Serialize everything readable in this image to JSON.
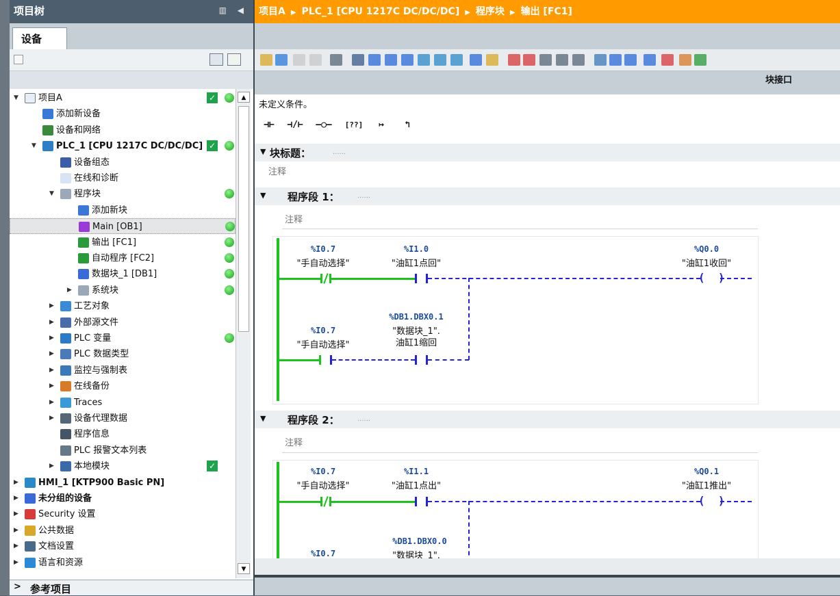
{
  "left_panel": {
    "header_title": "项目树",
    "device_tab": "设备",
    "tree": [
      {
        "label": "项目A",
        "arrow": "▼",
        "indent": 0,
        "bold": false,
        "icon": "project",
        "check": true,
        "dot": true
      },
      {
        "label": "添加新设备",
        "arrow": "",
        "indent": 1,
        "bold": false,
        "icon": "add-device"
      },
      {
        "label": "设备和网络",
        "arrow": "",
        "indent": 1,
        "bold": false,
        "icon": "network"
      },
      {
        "label": "PLC_1 [CPU 1217C DC/DC/DC]",
        "arrow": "▼",
        "indent": 1,
        "bold": true,
        "icon": "plc",
        "check": true,
        "dot": true
      },
      {
        "label": "设备组态",
        "arrow": "",
        "indent": 2,
        "bold": false,
        "icon": "device-config"
      },
      {
        "label": "在线和诊断",
        "arrow": "",
        "indent": 2,
        "bold": false,
        "icon": "diagnostics"
      },
      {
        "label": "程序块",
        "arrow": "▼",
        "indent": 2,
        "bold": false,
        "icon": "folder",
        "dot": true
      },
      {
        "label": "添加新块",
        "arrow": "",
        "indent": 3,
        "bold": false,
        "icon": "add-block"
      },
      {
        "label": "Main [OB1]",
        "arrow": "",
        "indent": 3,
        "bold": false,
        "icon": "ob",
        "dot": true,
        "selected": true
      },
      {
        "label": "输出 [FC1]",
        "arrow": "",
        "indent": 3,
        "bold": false,
        "icon": "fc",
        "dot": true
      },
      {
        "label": "自动程序 [FC2]",
        "arrow": "",
        "indent": 3,
        "bold": false,
        "icon": "fc",
        "dot": true
      },
      {
        "label": "数据块_1 [DB1]",
        "arrow": "",
        "indent": 3,
        "bold": false,
        "icon": "db",
        "dot": true
      },
      {
        "label": "系统块",
        "arrow": "▶",
        "indent": 3,
        "bold": false,
        "icon": "folder",
        "dot": true
      },
      {
        "label": "工艺对象",
        "arrow": "▶",
        "indent": 2,
        "bold": false,
        "icon": "tech"
      },
      {
        "label": "外部源文件",
        "arrow": "▶",
        "indent": 2,
        "bold": false,
        "icon": "ext"
      },
      {
        "label": "PLC 变量",
        "arrow": "▶",
        "indent": 2,
        "bold": false,
        "icon": "tags",
        "dot": true
      },
      {
        "label": "PLC 数据类型",
        "arrow": "▶",
        "indent": 2,
        "bold": false,
        "icon": "types"
      },
      {
        "label": "监控与强制表",
        "arrow": "▶",
        "indent": 2,
        "bold": false,
        "icon": "watch"
      },
      {
        "label": "在线备份",
        "arrow": "▶",
        "indent": 2,
        "bold": false,
        "icon": "backup"
      },
      {
        "label": "Traces",
        "arrow": "▶",
        "indent": 2,
        "bold": false,
        "icon": "traces"
      },
      {
        "label": "设备代理数据",
        "arrow": "▶",
        "indent": 2,
        "bold": false,
        "icon": "proxy"
      },
      {
        "label": "程序信息",
        "arrow": "",
        "indent": 2,
        "bold": false,
        "icon": "info"
      },
      {
        "label": "PLC 报警文本列表",
        "arrow": "",
        "indent": 2,
        "bold": false,
        "icon": "alarm"
      },
      {
        "label": "本地模块",
        "arrow": "▶",
        "indent": 2,
        "bold": false,
        "icon": "local",
        "check": true
      },
      {
        "label": "HMI_1 [KTP900 Basic PN]",
        "arrow": "▶",
        "indent": 0,
        "bold": true,
        "icon": "hmi"
      },
      {
        "label": "未分组的设备",
        "arrow": "▶",
        "indent": 0,
        "bold": true,
        "icon": "ungrouped"
      },
      {
        "label": "Security 设置",
        "arrow": "▶",
        "indent": 0,
        "bold": false,
        "icon": "security"
      },
      {
        "label": "公共数据",
        "arrow": "▶",
        "indent": 0,
        "bold": false,
        "icon": "common"
      },
      {
        "label": "文档设置",
        "arrow": "▶",
        "indent": 0,
        "bold": false,
        "icon": "docs"
      },
      {
        "label": "语言和资源",
        "arrow": "▶",
        "indent": 0,
        "bold": false,
        "icon": "lang"
      }
    ],
    "ref_projects": "参考项目"
  },
  "breadcrumb": [
    "项目A",
    "PLC_1 [CPU 1217C DC/DC/DC]",
    "程序块",
    "输出 [FC1]"
  ],
  "block_interface": "块接口",
  "editor": {
    "undefined_condition": "未定义条件。",
    "block_title_label": "块标题：",
    "block_comment": "注释",
    "segment1": {
      "title": "程序段 1：",
      "comment": "注释",
      "op_a_addr": "%I0.7",
      "op_a_name": "\"手自动选择\"",
      "op_b_addr": "%I1.0",
      "op_b_name": "\"油缸1点回\"",
      "coil_addr": "%Q0.0",
      "coil_name": "\"油缸1收回\"",
      "op_c_addr": "%I0.7",
      "op_c_name": "\"手自动选择\"",
      "op_d_addr": "%DB1.DBX0.1",
      "op_d_name1": "\"数据块_1\".",
      "op_d_name2": "油缸1缩回"
    },
    "segment2": {
      "title": "程序段 2：",
      "comment": "注释",
      "op_a_addr": "%I0.7",
      "op_a_name": "\"手自动选择\"",
      "op_b_addr": "%I1.1",
      "op_b_name": "\"油缸1点出\"",
      "coil_addr": "%Q0.1",
      "coil_name": "\"油缸1推出\"",
      "op_c_addr": "%I0.7",
      "op_d_addr": "%DB1.DBX0.0",
      "op_d_name1": "\"数据块_1\"."
    }
  }
}
